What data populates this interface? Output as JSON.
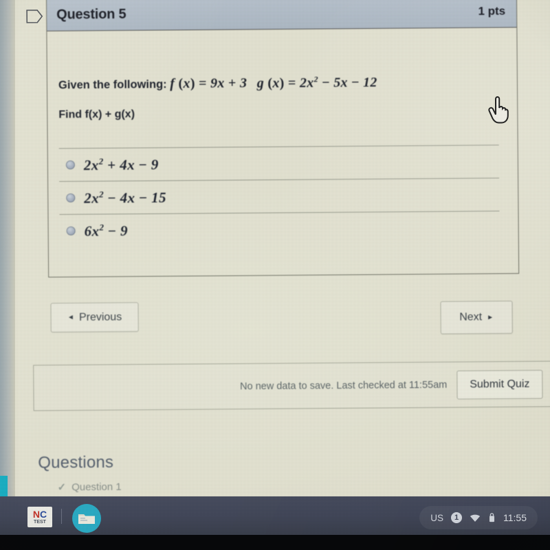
{
  "question": {
    "flag_icon": "flag-outline-icon",
    "title": "Question 5",
    "points": "1 pts",
    "prompt_prefix": "Given the following:",
    "prompt_f": "f (x) = 9x + 3",
    "prompt_g": "g (x) = 2x² − 5x − 12",
    "prompt_find": "Find f(x) + g(x)",
    "answers": [
      {
        "id": "a",
        "text": "2x² + 4x − 9",
        "selected": false
      },
      {
        "id": "b",
        "text": "2x² − 4x − 15",
        "selected": false
      },
      {
        "id": "c",
        "text": "6x² − 9",
        "selected": false
      }
    ]
  },
  "nav": {
    "previous_label": "Previous",
    "previous_arrow": "◄",
    "next_label": "Next",
    "next_arrow": "►"
  },
  "save_bar": {
    "status": "No new data to save. Last checked at 11:55am",
    "submit_label": "Submit Quiz"
  },
  "questions_panel": {
    "heading": "Questions",
    "items": [
      {
        "check": "✓",
        "label": "Question 1",
        "answered": true
      }
    ]
  },
  "cursor": {
    "icon": "pointing-hand-cursor"
  },
  "shelf": {
    "nc_icon": {
      "name": "nc-test-app-icon",
      "top_n": "N",
      "top_c": "C",
      "bottom": "TEST"
    },
    "files_icon": "files-folder-app-icon",
    "tray": {
      "keyboard_layout": "US",
      "notification_count": "1",
      "wifi_icon": "wifi-icon",
      "battery_icon": "battery-icon",
      "clock": "11:55"
    }
  },
  "colors": {
    "page_bg": "#e9e7d7",
    "header_bg": "#b2bdca",
    "header_text": "#1b1d26",
    "body_text": "#20242e",
    "muted_text": "#5c6268",
    "questions_heading": "#596372",
    "shelf_bg": "#454a5d",
    "accent_cyan": "#2cafc9",
    "nc_red": "#c9352b",
    "nc_blue": "#2f4fa0"
  }
}
